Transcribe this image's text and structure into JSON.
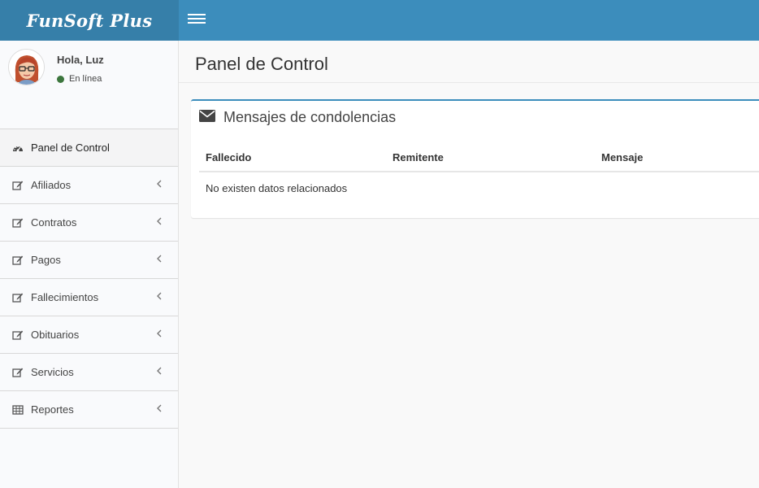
{
  "app": {
    "brand": "FunSoft Plus"
  },
  "user": {
    "greeting": "Hola, Luz",
    "status": "En línea",
    "status_color": "#3c763d"
  },
  "colors": {
    "topbar": "#3c8dbc",
    "logo_bg": "#367fa9",
    "accent": "#3c8dbc"
  },
  "sidebar": {
    "items": [
      {
        "label": "Panel de Control",
        "icon": "dashboard-icon"
      },
      {
        "label": "Afiliados",
        "icon": "edit-icon"
      },
      {
        "label": "Contratos",
        "icon": "edit-icon"
      },
      {
        "label": "Pagos",
        "icon": "edit-icon"
      },
      {
        "label": "Fallecimientos",
        "icon": "edit-icon"
      },
      {
        "label": "Obituarios",
        "icon": "edit-icon"
      },
      {
        "label": "Servicios",
        "icon": "edit-icon"
      },
      {
        "label": "Reportes",
        "icon": "table-icon"
      }
    ]
  },
  "header": {
    "title": "Panel de Control"
  },
  "box": {
    "title": "Mensajes de condolencias",
    "icon": "envelope-icon",
    "columns": [
      "Fallecido",
      "Remitente",
      "Mensaje"
    ],
    "empty_text": "No existen datos relacionados"
  }
}
